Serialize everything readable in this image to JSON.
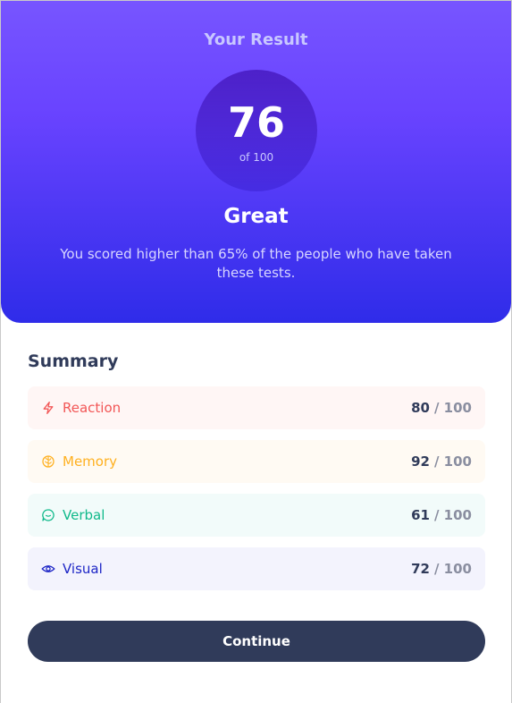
{
  "result": {
    "title": "Your Result",
    "score": "76",
    "score_of": "of 100",
    "rating": "Great",
    "description": "You scored higher than 65% of the people who have taken these tests."
  },
  "summary": {
    "title": "Summary",
    "items": [
      {
        "label": "Reaction",
        "score": "80",
        "max": "/ 100",
        "icon": "lightning-icon",
        "color": "#f25757"
      },
      {
        "label": "Memory",
        "score": "92",
        "max": "/ 100",
        "icon": "brain-icon",
        "color": "#ffb01f"
      },
      {
        "label": "Verbal",
        "score": "61",
        "max": "/ 100",
        "icon": "chat-bubble-icon",
        "color": "#0fb98a"
      },
      {
        "label": "Visual",
        "score": "72",
        "max": "/ 100",
        "icon": "eye-icon",
        "color": "#1d25c6"
      }
    ]
  },
  "actions": {
    "continue_label": "Continue"
  },
  "colors": {
    "gradient_top": "#7755ff",
    "gradient_bottom": "#2f2ce9",
    "dark_navy": "#303b5a"
  }
}
